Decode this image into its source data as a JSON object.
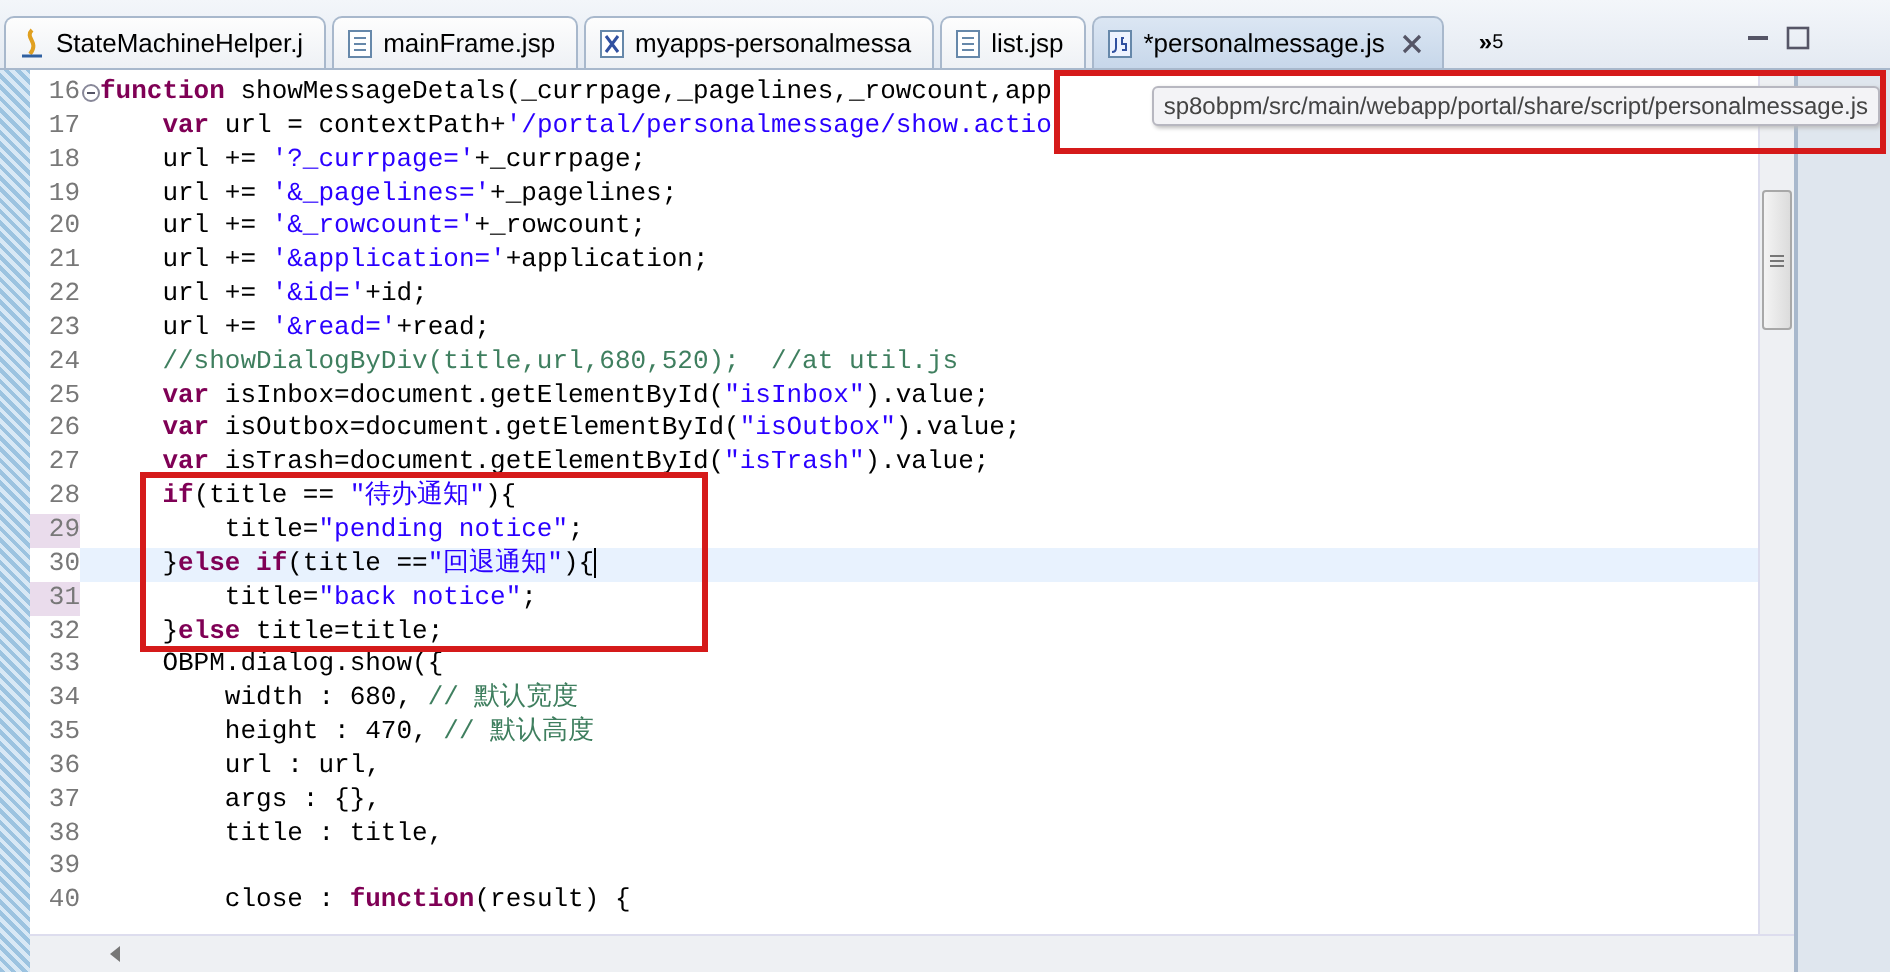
{
  "tabs": [
    {
      "label": "StateMachineHelper.j",
      "kind": "java",
      "selected": false
    },
    {
      "label": "mainFrame.jsp",
      "kind": "file",
      "selected": false
    },
    {
      "label": "myapps-personalmessa",
      "kind": "xml",
      "selected": false
    },
    {
      "label": "list.jsp",
      "kind": "file",
      "selected": false
    },
    {
      "label": "*personalmessage.js",
      "kind": "js",
      "selected": true
    }
  ],
  "overflow": {
    "glyph": "»",
    "count": "5"
  },
  "editor": {
    "lines": [
      {
        "number": "16",
        "fold": true,
        "tokens": [
          {
            "kind": "keyword",
            "text": "function"
          },
          {
            "kind": "plain",
            "text": " showMessageDetals(_currpage,_pagelines,_rowcount,app"
          }
        ]
      },
      {
        "number": "17",
        "tokens": [
          {
            "kind": "keyword",
            "text": "    var"
          },
          {
            "kind": "plain",
            "text": " url = contextPath+"
          },
          {
            "kind": "string",
            "text": "'/portal/personalmessage/show.actio"
          }
        ]
      },
      {
        "number": "18",
        "tokens": [
          {
            "kind": "plain",
            "text": "    url += "
          },
          {
            "kind": "string",
            "text": "'?_currpage='"
          },
          {
            "kind": "plain",
            "text": "+_currpage;"
          }
        ]
      },
      {
        "number": "19",
        "tokens": [
          {
            "kind": "plain",
            "text": "    url += "
          },
          {
            "kind": "string",
            "text": "'&_pagelines='"
          },
          {
            "kind": "plain",
            "text": "+_pagelines;"
          }
        ]
      },
      {
        "number": "20",
        "tokens": [
          {
            "kind": "plain",
            "text": "    url += "
          },
          {
            "kind": "string",
            "text": "'&_rowcount='"
          },
          {
            "kind": "plain",
            "text": "+_rowcount;"
          }
        ]
      },
      {
        "number": "21",
        "tokens": [
          {
            "kind": "plain",
            "text": "    url += "
          },
          {
            "kind": "string",
            "text": "'&application='"
          },
          {
            "kind": "plain",
            "text": "+application;"
          }
        ]
      },
      {
        "number": "22",
        "tokens": [
          {
            "kind": "plain",
            "text": "    url += "
          },
          {
            "kind": "string",
            "text": "'&id='"
          },
          {
            "kind": "plain",
            "text": "+id;"
          }
        ]
      },
      {
        "number": "23",
        "tokens": [
          {
            "kind": "plain",
            "text": "    url += "
          },
          {
            "kind": "string",
            "text": "'&read='"
          },
          {
            "kind": "plain",
            "text": "+read;"
          }
        ]
      },
      {
        "number": "24",
        "tokens": [
          {
            "kind": "comment",
            "text": "    //showDialogByDiv(title,url,680,520);  //at util.js"
          }
        ]
      },
      {
        "number": "25",
        "tokens": [
          {
            "kind": "keyword",
            "text": "    var"
          },
          {
            "kind": "plain",
            "text": " isInbox=document.getElementById("
          },
          {
            "kind": "string",
            "text": "\"isInbox\""
          },
          {
            "kind": "plain",
            "text": ").value;"
          }
        ]
      },
      {
        "number": "26",
        "tokens": [
          {
            "kind": "keyword",
            "text": "    var"
          },
          {
            "kind": "plain",
            "text": " isOutbox=document.getElementById("
          },
          {
            "kind": "string",
            "text": "\"isOutbox\""
          },
          {
            "kind": "plain",
            "text": ").value;"
          }
        ]
      },
      {
        "number": "27",
        "tokens": [
          {
            "kind": "keyword",
            "text": "    var"
          },
          {
            "kind": "plain",
            "text": " isTrash=document.getElementById("
          },
          {
            "kind": "string",
            "text": "\"isTrash\""
          },
          {
            "kind": "plain",
            "text": ").value;"
          }
        ]
      },
      {
        "number": "28",
        "tokens": [
          {
            "kind": "keyword",
            "text": "    if"
          },
          {
            "kind": "plain",
            "text": "(title == "
          },
          {
            "kind": "string",
            "text": "\"待办通知\""
          },
          {
            "kind": "plain",
            "text": "){"
          }
        ]
      },
      {
        "number": "29",
        "changed": true,
        "tokens": [
          {
            "kind": "plain",
            "text": "        title="
          },
          {
            "kind": "string",
            "text": "\"pending notice\""
          },
          {
            "kind": "plain",
            "text": ";"
          }
        ]
      },
      {
        "number": "30",
        "current": true,
        "tokens": [
          {
            "kind": "plain",
            "text": "    }"
          },
          {
            "kind": "keyword",
            "text": "else if"
          },
          {
            "kind": "plain",
            "text": "(title =="
          },
          {
            "kind": "string",
            "text": "\"回退通知\""
          },
          {
            "kind": "plain",
            "text": "){"
          }
        ]
      },
      {
        "number": "31",
        "changed": true,
        "tokens": [
          {
            "kind": "plain",
            "text": "        title="
          },
          {
            "kind": "string",
            "text": "\"back notice\""
          },
          {
            "kind": "plain",
            "text": ";"
          }
        ]
      },
      {
        "number": "32",
        "tokens": [
          {
            "kind": "plain",
            "text": "    }"
          },
          {
            "kind": "keyword",
            "text": "else"
          },
          {
            "kind": "plain",
            "text": " title=title;"
          }
        ]
      },
      {
        "number": "33",
        "tokens": [
          {
            "kind": "plain",
            "text": "    OBPM.dialog.show({"
          }
        ]
      },
      {
        "number": "34",
        "tokens": [
          {
            "kind": "plain",
            "text": "        width : 680, "
          },
          {
            "kind": "comment",
            "text": "// 默认宽度"
          }
        ]
      },
      {
        "number": "35",
        "tokens": [
          {
            "kind": "plain",
            "text": "        height : 470, "
          },
          {
            "kind": "comment",
            "text": "// 默认高度"
          }
        ]
      },
      {
        "number": "36",
        "tokens": [
          {
            "kind": "plain",
            "text": "        url : url,"
          }
        ]
      },
      {
        "number": "37",
        "tokens": [
          {
            "kind": "plain",
            "text": "        args : {},"
          }
        ]
      },
      {
        "number": "38",
        "tokens": [
          {
            "kind": "plain",
            "text": "        title : title,"
          }
        ]
      },
      {
        "number": "39"
      },
      {
        "number": "40",
        "tokens": [
          {
            "kind": "plain",
            "text": "        close : "
          },
          {
            "kind": "keyword",
            "text": "function"
          },
          {
            "kind": "plain",
            "text": "(result) {"
          }
        ]
      }
    ]
  },
  "tooltip": {
    "text": "sp8obpm/src/main/webapp/portal/share/script/personalmessage.js"
  }
}
